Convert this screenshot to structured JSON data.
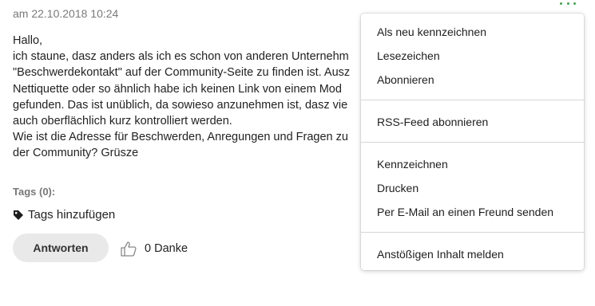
{
  "post": {
    "timestamp": "am 22.10.2018 10:24",
    "lines": [
      "Hallo,",
      "ich staune, dasz anders als ich es schon von anderen Unternehm",
      "\"Beschwerdekontakt\" auf der Community-Seite zu finden ist. Ausz",
      "Nettiquette oder so ähnlich habe ich keinen Link von einem Mod",
      "gefunden. Das ist unüblich, da sowieso anzunehmen ist, dasz vie",
      "auch oberflächlich kurz kontrolliert werden.",
      "Wie ist die Adresse für Beschwerden, Anregungen und Fragen zu",
      "der Community? Grüsze"
    ]
  },
  "tags": {
    "label": "Tags (0):",
    "add_label": "Tags hinzufügen"
  },
  "actions": {
    "reply_label": "Antworten",
    "thanks_label": "0 Danke"
  },
  "menu": {
    "group1": [
      "Als neu kennzeichnen",
      "Lesezeichen",
      "Abonnieren"
    ],
    "group2": [
      "RSS-Feed abonnieren"
    ],
    "group3": [
      "Kennzeichnen",
      "Drucken",
      "Per E-Mail an einen Freund senden"
    ],
    "group4": [
      "Anstößigen Inhalt melden"
    ]
  },
  "colors": {
    "accent_dots": "#3fa34d",
    "button_bg": "#e9e9e9"
  },
  "icons": [
    "tag-icon",
    "thumbs-up-icon",
    "more-options-icon"
  ]
}
